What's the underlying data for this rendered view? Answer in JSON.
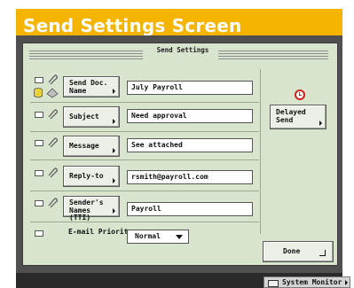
{
  "title": "Send Settings Screen",
  "screen_label": "Send Settings",
  "rows": [
    {
      "button_label": "Send Doc. Name",
      "value": "July Payroll"
    },
    {
      "button_label": "Subject",
      "value": "Need approval"
    },
    {
      "button_label": "Message",
      "value": "See attached"
    },
    {
      "button_label": "Reply-to",
      "value": "rsmith@payroll.com"
    },
    {
      "button_label": "Sender's Names (TTI)",
      "value": "Payroll"
    }
  ],
  "priority": {
    "label": "E-mail Priority",
    "selected": "Normal"
  },
  "delayed_send": {
    "label": "Delayed Send",
    "icon": "clock-icon"
  },
  "done_label": "Done",
  "system_monitor_label": "System Monitor",
  "colors": {
    "banner": "#f5b400",
    "panel": "#d8e4ce",
    "outer": "#4f4f4f",
    "clock": "#d02020"
  }
}
